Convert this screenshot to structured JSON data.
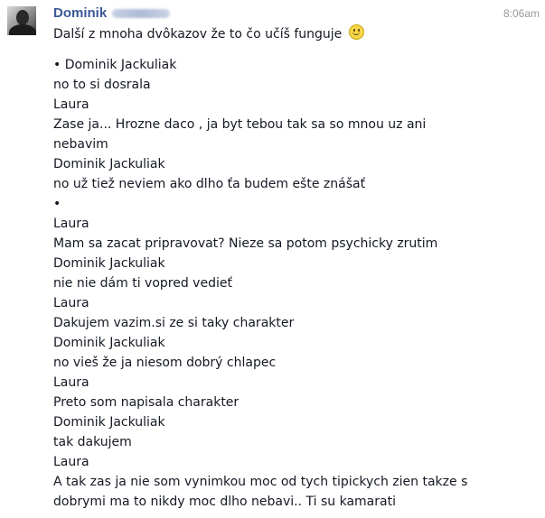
{
  "message": {
    "sender_name": "Dominik",
    "timestamp": "8:06am",
    "intro_text": "Další z mnoha dvôkazov že to čo učíš funguje",
    "intro_emoticon": "smiley-icon",
    "lines": [
      "• Dominik Jackuliak",
      "no to si dosrala",
      "Laura",
      "Zase ja... Hrozne daco , ja byt tebou tak sa so mnou uz ani",
      "nebavim",
      "Dominik Jackuliak",
      "no už tiež neviem ako dlho ťa budem ešte znášať",
      "•",
      "Laura",
      "Mam sa zacat pripravovat? Nieze sa potom psychicky zrutim",
      "Dominik Jackuliak",
      "nie nie dám ti vopred vedieť",
      "Laura",
      "Dakujem vazim.si ze si taky charakter",
      "Dominik Jackuliak",
      "no vieš že ja niesom dobrý chlapec",
      "Laura",
      "Preto som napisala charakter",
      "Dominik Jackuliak",
      "tak dakujem",
      "Laura",
      "A tak zas ja nie som vynimkou moc od tych tipickych zien takze s",
      "dobrymi ma to nikdy moc dlho nebavi.. Ti su kamarati"
    ]
  },
  "colors": {
    "sender_name": "#3b5998",
    "body_text": "#141823",
    "timestamp": "#999999"
  }
}
